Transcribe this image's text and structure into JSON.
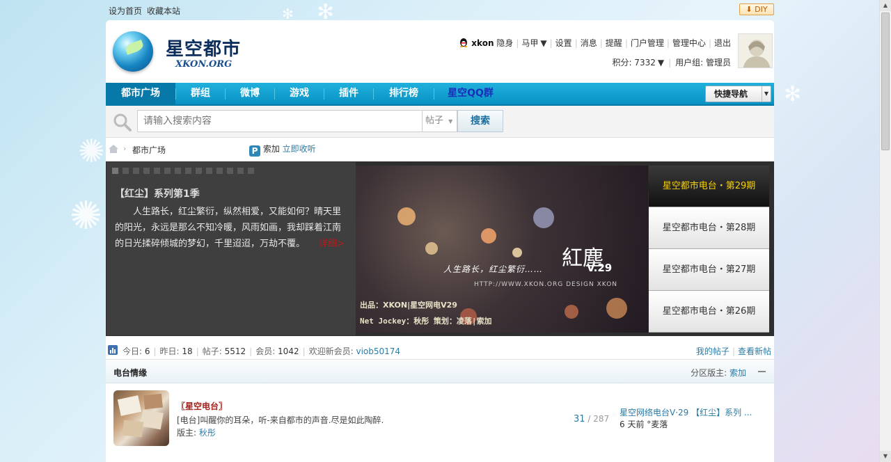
{
  "topbar": {
    "set_home": "设为首页",
    "bookmark": "收藏本站",
    "diy": "DIY"
  },
  "site": {
    "logo_cn": "星空都市",
    "logo_en": "XKON.ORG"
  },
  "user": {
    "name": "xkon",
    "invisible": "隐身",
    "links": [
      "马甲",
      "设置",
      "消息",
      "提醒",
      "门户管理",
      "管理中心",
      "退出"
    ],
    "points_label": "积分: 7332",
    "group_label": "用户组: 管理员"
  },
  "nav": {
    "items": [
      "都市广场",
      "群组",
      "微博",
      "游戏",
      "插件",
      "排行榜",
      "星空QQ群"
    ],
    "quick_nav": "快捷导航"
  },
  "search": {
    "placeholder": "请输入搜索内容",
    "type": "帖子",
    "button": "搜索"
  },
  "breadcrumb": {
    "current": "都市广场",
    "weibo_user": "索加",
    "weibo_link": "立即收听"
  },
  "slider": {
    "title": "【红尘】系列第1季",
    "text": "人生路长，红尘繁衍，纵然相爱，又能如何？晴天里的阳光，永远是那么不知冷暖，风雨如画，我却踩着江南的日光揉碎倾城的梦幻，千里迢迢，万劫不覆。",
    "more": "详细>",
    "image": {
      "caption": "人生路长，红尘繁衍……",
      "url_text": "HTTP://WWW.XKON.ORG DESIGN XKON",
      "title": "紅塵",
      "version": "V.29",
      "credit1": "出品：XKON|星空网电V29",
      "credit2": "Net Jockey：秋彤 策划：凌落|索加"
    },
    "episodes": [
      "星空都市电台・第29期",
      "星空都市电台・第28期",
      "星空都市电台・第27期",
      "星空都市电台・第26期"
    ]
  },
  "stats": {
    "today": "今日: ",
    "today_val": "6",
    "yesterday": "昨日: ",
    "yesterday_val": "18",
    "posts": "帖子: ",
    "posts_val": "5512",
    "members": "会员: ",
    "members_val": "1042",
    "newest": "欢迎新会员: ",
    "newest_val": "viob50174",
    "my_posts": "我的帖子",
    "new_posts": "查看新帖"
  },
  "forum": {
    "section": "电台情缘",
    "moderator_label": "分区版主: ",
    "moderator": "索加",
    "name": "〖星空电台〗",
    "desc": "[电台]叫醒你的耳朵，听-来自都市的声音.尽是如此陶醉.",
    "mod_label": "版主: ",
    "mod": "秋彤",
    "threads": "31",
    "slash": " / ",
    "posts": "287",
    "last_title": "星空网络电台V·29 【红尘】系列 ...",
    "last_meta": "6 天前 °麦落"
  },
  "colors": {
    "nav": "#0892c4",
    "link": "#2a7ba6",
    "active_episode": "#f7d000"
  }
}
